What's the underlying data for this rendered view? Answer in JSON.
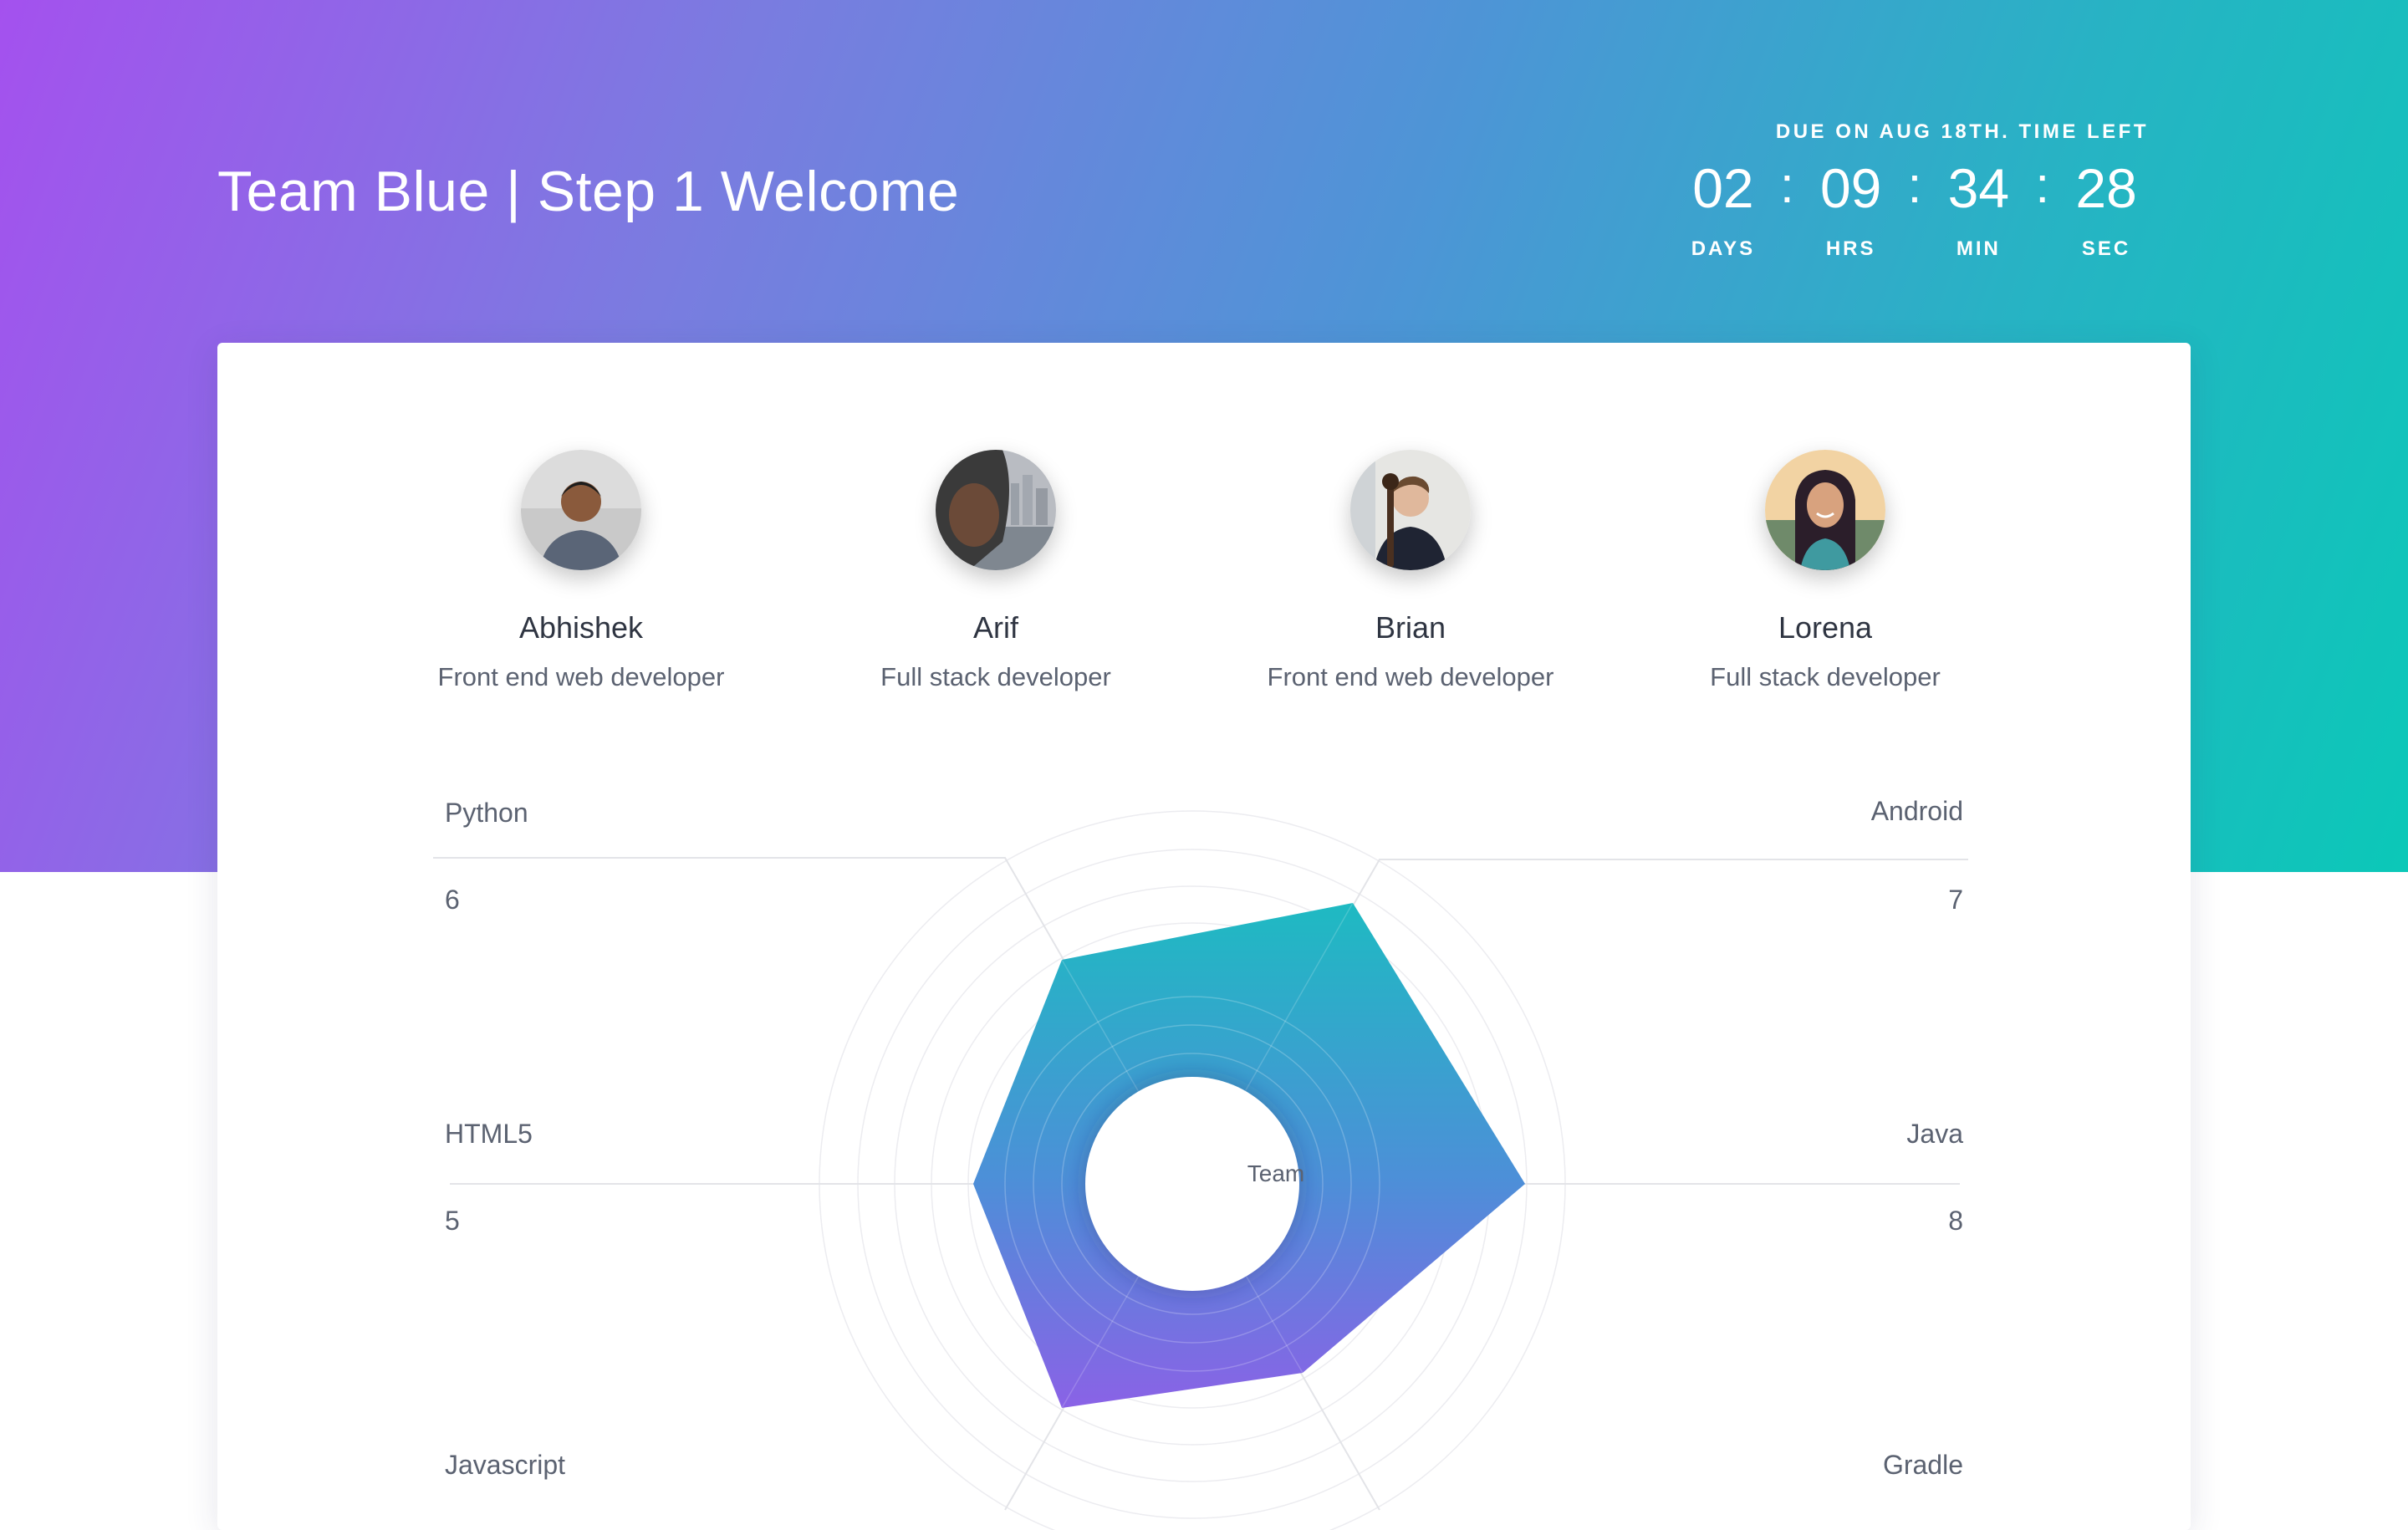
{
  "header": {
    "title": "Team Blue | Step 1 Welcome"
  },
  "countdown": {
    "due_label": "DUE ON AUG 18TH. TIME LEFT",
    "separator": ":",
    "units": [
      {
        "value": "02",
        "label": "DAYS"
      },
      {
        "value": "09",
        "label": "HRS"
      },
      {
        "value": "34",
        "label": "MIN"
      },
      {
        "value": "28",
        "label": "SEC"
      }
    ]
  },
  "members": [
    {
      "name": "Abhishek",
      "role": "Front end web developer"
    },
    {
      "name": "Arif",
      "role": "Full stack developer"
    },
    {
      "name": "Brian",
      "role": "Front end web developer"
    },
    {
      "name": "Lorena",
      "role": "Full stack developer"
    }
  ],
  "skills": {
    "center_label": "Team",
    "items": [
      {
        "name": "Python",
        "score": "6"
      },
      {
        "name": "Android",
        "score": "7"
      },
      {
        "name": "HTML5",
        "score": "5"
      },
      {
        "name": "Java",
        "score": "8"
      },
      {
        "name": "Javascript",
        "score": ""
      },
      {
        "name": "Gradle",
        "score": ""
      }
    ]
  },
  "colors": {
    "hero_start": "#a451ee",
    "hero_end": "#0bc8b8",
    "radar_top": "#1ebac2",
    "radar_bottom": "#8a62e6"
  }
}
